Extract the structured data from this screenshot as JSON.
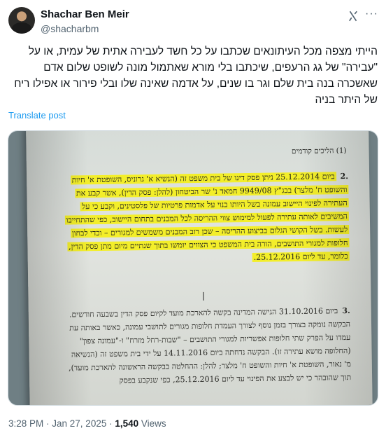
{
  "author": {
    "display_name": "Shachar Ben Meir",
    "handle": "@shacharbm"
  },
  "tweet": {
    "text": "הייתי מצפה מכל העיתונאים שכתבו על כל חשד לעבירה אתית של עמית, או על \"עבירה\" של גג הרעפים, שיכתבו בלי מורא שאתמול מונה לשופט שלום אדם שאשכרה בנה בית שלם וגר בו שנים, על אדמה שאינה שלו ובלי פירור או אפילו ריח של היתר בניה",
    "translate_label": "Translate post"
  },
  "media": {
    "section_title": "(1) הליכים קודמים",
    "para2_number": ".2",
    "para2_text": "ביום 25.12.2014 ניתן פסק דינו של בית משפט זה (הנשיא א' גרוניס, השופטת א' חיות והשופט ח' מלצר) בבג\"ץ 9949/08 חמאד נ' שר הביטחון (להלן: פסק הדין), אשר קבע את העתירה לפינוי היישוב עמונה בשל היותו בנוי על אדמות פרטיות של פלסטינים, וקבע כי על המשיבים לאותה עתירה לפעול למימוש צווי ההריסה לכל המבנים בתחום היישוב, כפי שהתחייבו לעשות. בשל הקושי הגלום בביצוע ההריסה – שכן רוב המבנים משמשים למגורים – וכדי לבחון חלופות למגורי התושבים, הורה בית המשפט כי הצווים יומשו בתוך שנתיים מיום מתן פסק הדין, כלומר, עד ליום 25.12.2016.",
    "para3_number": ".3",
    "para3_text": "ביום 31.10.2016 הגישה המדינה בקשה להארכת מועד לקיום פסק הדין בשבעה חודשים. הבקשה נומקה בצורך בזמן נוסף לצורך העמדת חלופות מגורים לתושבי עמונה, כאשר באותה עת עמדו על הפרק שתי חלופות אפשריות למגורי התושבים – \"שבות-רחל מזרח\" ו-\"עמונה צפון\" (החלופה מושא עתירה זו). הבקשה נדחתה ביום 14.11.2016 על ידי בית משפט זה (הנשיאה מ' נאור, השופטת א' חיות והשופט ח' מלצר; להלן: ההחלטה בבקשה הראשונה להארכת מועד), תוך שהובהר כי יש לבצע את הפינוי עד ליום 25.12.2016, כפי שנקבע בפסק"
  },
  "meta": {
    "timestamp": "3:28 PM · Jan 27, 2025 · ",
    "views_count": "1,540",
    "views_label": " Views"
  },
  "icons": {
    "grok": "grok-icon",
    "more": "more-icon"
  },
  "colors": {
    "link": "#1d9bf0",
    "secondary_text": "#536471",
    "highlight": "#f3ee2a"
  }
}
